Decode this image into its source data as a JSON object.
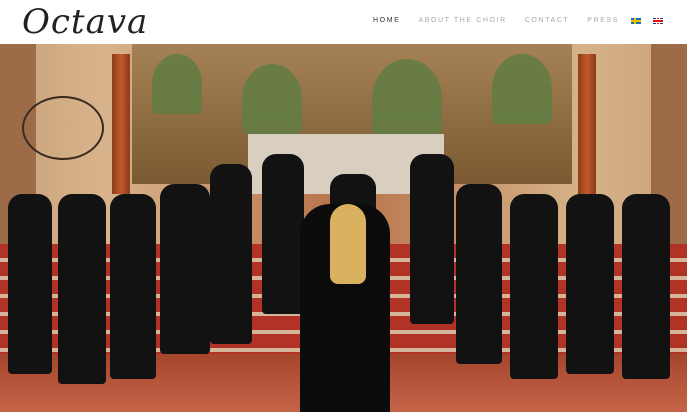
{
  "header": {
    "logo_text": "Octava",
    "nav": [
      {
        "label": "HOME",
        "active": true
      },
      {
        "label": "ABOUT THE CHOIR",
        "active": false
      },
      {
        "label": "CONTACT",
        "active": false
      },
      {
        "label": "PRESS",
        "active": false
      }
    ],
    "languages": [
      {
        "code": "sv"
      },
      {
        "code": "en"
      }
    ]
  },
  "hero": {
    "image_semantic": "choir-performing-in-church",
    "colors": {
      "wall": "#d8b48c",
      "carpet": "#b23326",
      "floor": "#c56447"
    }
  }
}
